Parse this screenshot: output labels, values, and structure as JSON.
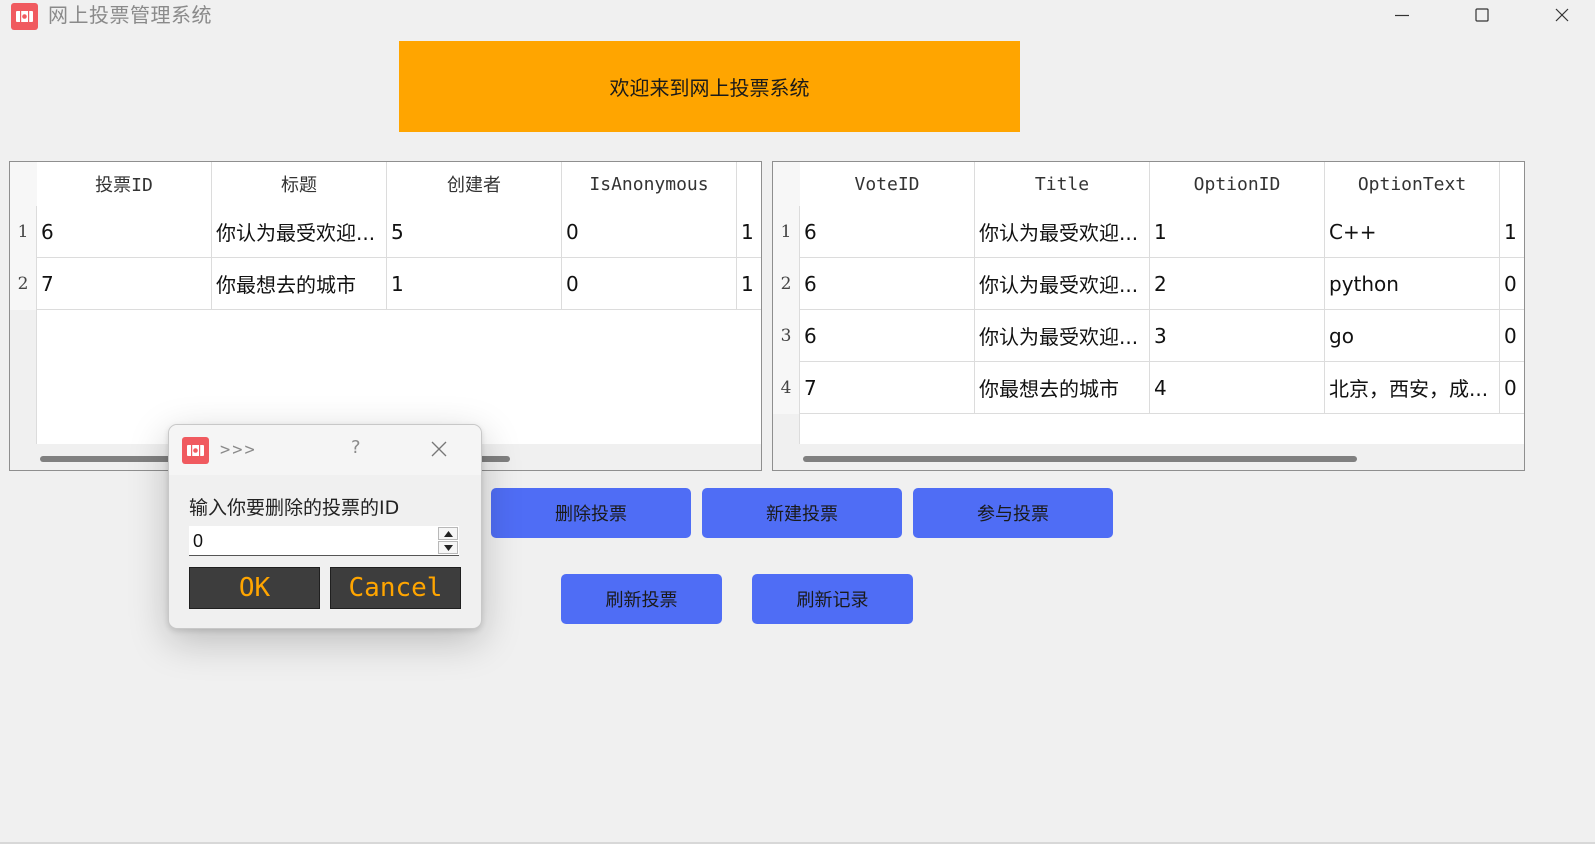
{
  "window": {
    "title": "网上投票管理系统",
    "icon": "app-ticket-icon",
    "controls": [
      "minimize-icon",
      "maximize-icon",
      "close-icon"
    ]
  },
  "banner": {
    "text": "欢迎来到网上投票系统"
  },
  "votes_table": {
    "headers": [
      "投票ID",
      "标题",
      "创建者",
      "IsAnonymous",
      ""
    ],
    "rows": [
      {
        "num": "1",
        "cells": [
          "6",
          "你认为最受欢迎...",
          "5",
          "0",
          "1"
        ]
      },
      {
        "num": "2",
        "cells": [
          "7",
          "你最想去的城市",
          "1",
          "0",
          "1"
        ]
      }
    ]
  },
  "options_table": {
    "headers": [
      "VoteID",
      "Title",
      "OptionID",
      "OptionText",
      ""
    ],
    "rows": [
      {
        "num": "1",
        "cells": [
          "6",
          "你认为最受欢迎...",
          "1",
          "C++",
          "1"
        ]
      },
      {
        "num": "2",
        "cells": [
          "6",
          "你认为最受欢迎...",
          "2",
          "python",
          "0"
        ]
      },
      {
        "num": "3",
        "cells": [
          "6",
          "你认为最受欢迎...",
          "3",
          "go",
          "0"
        ]
      },
      {
        "num": "4",
        "cells": [
          "7",
          "你最想去的城市",
          "4",
          "北京，西安，成...",
          "0"
        ]
      }
    ]
  },
  "actions": {
    "delete_vote": "删除投票",
    "new_vote": "新建投票",
    "join_vote": "参与投票",
    "refresh_votes": "刷新投票",
    "refresh_records": "刷新记录"
  },
  "dialog": {
    "title": ">>>",
    "help": "?",
    "prompt": "输入你要删除的投票的ID",
    "value": "0",
    "ok": "OK",
    "cancel": "Cancel"
  },
  "colors": {
    "banner": "#ffa500",
    "action_button": "#4f6df5",
    "dialog_button_bg": "#3d3d3d",
    "dialog_button_text": "#ffa500",
    "app_icon": "#f05a5f"
  }
}
